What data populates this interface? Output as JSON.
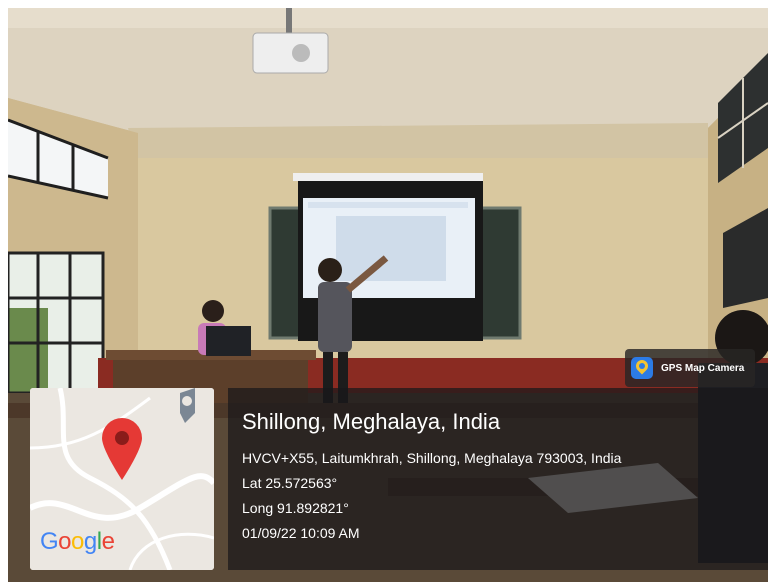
{
  "gps_badge": {
    "app_name": "GPS Map Camera"
  },
  "location": {
    "title": "Shillong, Meghalaya, India",
    "address": "HVCV+X55, Laitumkhrah, Shillong, Meghalaya 793003, India",
    "lat": "Lat 25.572563°",
    "long": "Long 91.892821°",
    "datetime": "01/09/22 10:09 AM"
  },
  "map": {
    "logo_letters": [
      "G",
      "o",
      "o",
      "g",
      "l",
      "e"
    ],
    "logo_colors": [
      "#4285F4",
      "#EA4335",
      "#FBBC05",
      "#4285F4",
      "#34A853",
      "#EA4335"
    ],
    "pin_color": "#E53935"
  }
}
